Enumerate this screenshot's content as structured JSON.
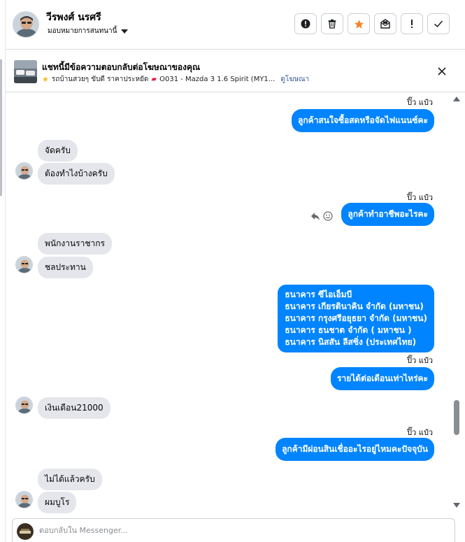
{
  "header": {
    "contact_name": "วีรพงศ์ นรศรี",
    "assign_label": "มอบหมายการสนทนานี้",
    "toolbar": [
      {
        "icon": "alert-circle-icon",
        "label": "Mark as spam"
      },
      {
        "icon": "trash-icon",
        "label": "Delete"
      },
      {
        "icon": "star-icon",
        "label": "Star"
      },
      {
        "icon": "mark-unread-icon",
        "label": "Mark unread"
      },
      {
        "icon": "exclamation-icon",
        "label": "Follow up"
      },
      {
        "icon": "check-icon",
        "label": "Done"
      }
    ]
  },
  "ad": {
    "title": "แชทนี้มีข้อความตอบกลับต่อโฆษณาของคุณ",
    "subtitle": "รถบ้านสวยๆ ขับดี ราคาประหยัด",
    "car_text": "O031 - Mazda 3 1.6 Spirit (MY1...",
    "link": "ดูโฆษณา"
  },
  "messages": [
    {
      "type": "timestamp",
      "text": "ปิ๊ว แป๋ว"
    },
    {
      "type": "out",
      "text": "ลูกค้าสนใจซื้อสดหรือจัดไฟแนนซ์คะ"
    },
    {
      "type": "in",
      "text": "จัดครับ"
    },
    {
      "type": "in",
      "text": "ต้องทำไงบ้างครับ"
    },
    {
      "type": "timestamp",
      "text": "ปิ๊ว แป๋ว"
    },
    {
      "type": "out",
      "text": "ลูกค้าทำอาชีพอะไรคะ"
    },
    {
      "type": "in",
      "text": "พนักงานราชากร"
    },
    {
      "type": "in",
      "text": "ชลประทาน"
    },
    {
      "type": "out",
      "lines": [
        "ธนาคาร ซีไอเอ็มบี",
        "ธนาคาร เกียรตินาคิน จำกัด (มหาชน)",
        "ธนาคาร กรุงศรีอยุธยา จำกัด (มหาชน)",
        "ธนาคาร ธนชาต จำกัด ( มหาชน )",
        "ธนาคาร  นิสสัน ลีสซิ่ง (ประเทศไทย)"
      ]
    },
    {
      "type": "timestamp",
      "text": "ปิ๊ว แป๋ว"
    },
    {
      "type": "out",
      "text": "รายได้ต่อเดือนเท่าไหร่คะ"
    },
    {
      "type": "in",
      "text": "เงินเดือน21000"
    },
    {
      "type": "timestamp",
      "text": "ปิ๊ว แป๋ว"
    },
    {
      "type": "out",
      "text": "ลูกค้ามีผ่อนสินเชื่ออะไรอยู่ไหมคะปัจจุบัน"
    },
    {
      "type": "in",
      "text": "ไม่ได้แล้วครับ"
    },
    {
      "type": "in",
      "text": "ผมบูโร"
    }
  ],
  "composer": {
    "placeholder": "ตอบกลับใน Messenger..."
  },
  "colors": {
    "outgoing_bubble": "#0084ff",
    "incoming_bubble": "#e4e6eb",
    "star_active": "#f5842a"
  }
}
